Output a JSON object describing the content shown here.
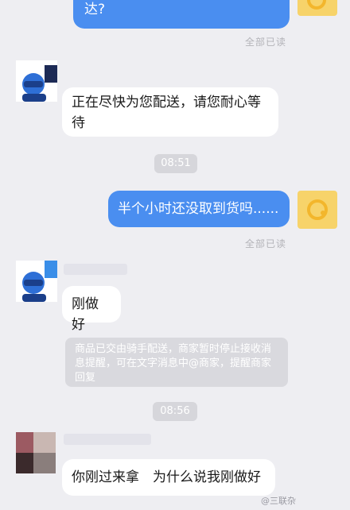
{
  "messages": {
    "out_1": {
      "text": "达?",
      "status": "全部已读"
    },
    "in_1": {
      "text": "正在尽快为您配送，请您耐心等待"
    },
    "time_1": "08:51",
    "out_2": {
      "text": "半个小时还没取到货吗......",
      "status": "全部已读"
    },
    "in_2": {
      "text": "刚做好"
    },
    "system": {
      "text": "商品已交由骑手配送，商家暂时停止接收消息提醒，可在文字消息中@商家，提醒商家回复"
    },
    "time_2": "08:56",
    "in_3": {
      "text": "你刚过来拿　为什么说我刚做好"
    }
  },
  "watermark": "@三联杂",
  "colors": {
    "accent": "#4a8ef0",
    "background": "#eeeef2",
    "user_avatar": "#f5c842"
  }
}
